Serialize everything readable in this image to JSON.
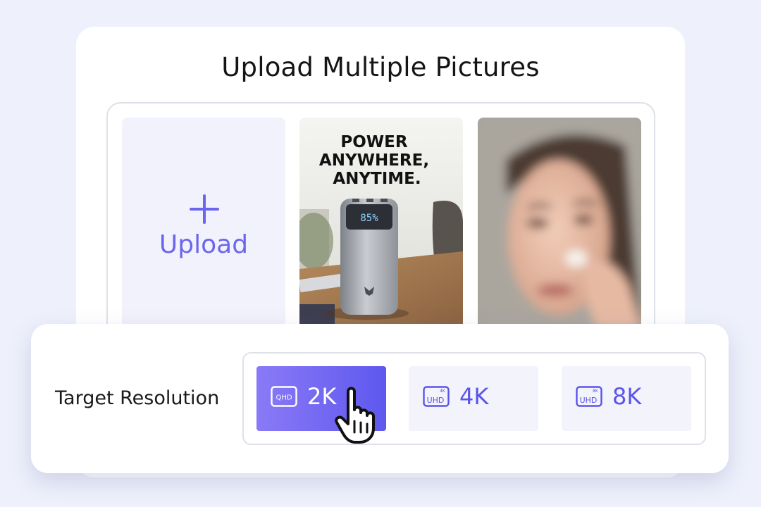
{
  "title": "Upload Multiple Pictures",
  "upload": {
    "label": "Upload",
    "icon": "plus-icon"
  },
  "photos": [
    {
      "name": "power-bank-ad",
      "headline": "POWER ANYWHERE, ANYTIME.",
      "headline_lines": [
        "POWER",
        "ANYWHERE,",
        "ANYTIME."
      ],
      "screen_text": "85%"
    },
    {
      "name": "woman-applying-cream"
    }
  ],
  "resolution": {
    "label": "Target Resolution",
    "selected": "2K",
    "options": [
      {
        "value": "2K",
        "badge": "QHD",
        "badge_sup": "",
        "active": true
      },
      {
        "value": "4K",
        "badge": "UHD",
        "badge_sup": "4K",
        "active": false
      },
      {
        "value": "8K",
        "badge": "UHD",
        "badge_sup": "8K",
        "active": false
      }
    ]
  },
  "colors": {
    "accent": "#6c66ee",
    "accent_gradient_start": "#8a7af7",
    "accent_gradient_end": "#5e58ee",
    "page_bg": "#eef1fb"
  },
  "cursor_icon": "hand-pointer-icon"
}
